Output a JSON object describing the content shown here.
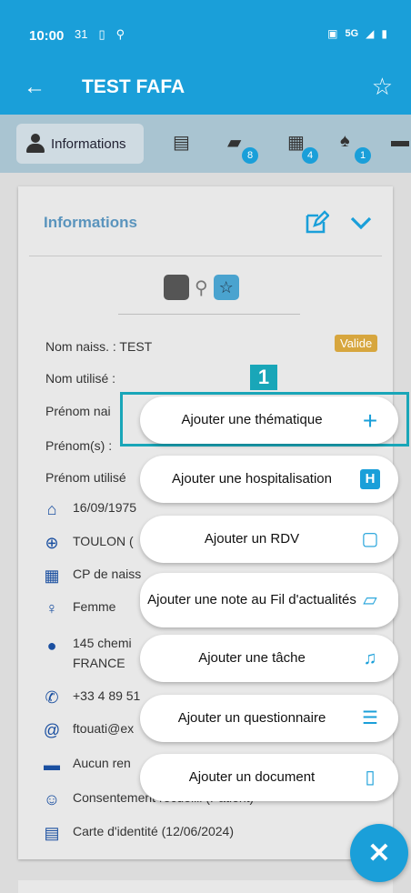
{
  "status": {
    "time": "10:00",
    "left_icons": [
      "31",
      "▯",
      "⚲"
    ],
    "net": "5G"
  },
  "appbar": {
    "back": "←",
    "title": "TEST FAFA",
    "star": "☆"
  },
  "tabs": {
    "info_label": "Informations",
    "badges": {
      "folder": "8",
      "forms": "4",
      "bell": "1"
    }
  },
  "card": {
    "title": "Informations",
    "status": "Valide"
  },
  "fields": [
    "Nom naiss. :  TEST",
    "Nom utilisé :",
    "Prénom nai",
    "Prénom(s) :",
    "Prénom utilisé"
  ],
  "details": [
    {
      "icon": "cake-icon",
      "glyph": "⌂",
      "text": "16/09/1975"
    },
    {
      "icon": "globe-icon",
      "glyph": "⊕",
      "text": "TOULON ("
    },
    {
      "icon": "building-icon",
      "glyph": "▦",
      "text": "CP de naiss"
    },
    {
      "icon": "gender-icon",
      "glyph": "♀",
      "text": "Femme"
    },
    {
      "icon": "location-icon",
      "glyph": "●",
      "text": "145 chemi\nFRANCE"
    },
    {
      "icon": "phone-icon",
      "glyph": "✆",
      "text": "+33 4 89 51"
    },
    {
      "icon": "at-icon",
      "glyph": "@",
      "text": "ftouati@ex"
    },
    {
      "icon": "calendar-icon",
      "glyph": "▬",
      "text": "Aucun ren"
    },
    {
      "icon": "smiley-icon",
      "glyph": "☺",
      "text": "Consentement recueilli (Patient)"
    },
    {
      "icon": "id-card-icon",
      "glyph": "▤",
      "text": "Carte d'identité (12/06/2024)"
    }
  ],
  "highlight_number": "1",
  "actions": [
    {
      "label": "Ajouter une thématique",
      "icon": "plus-icon",
      "glyph": "+"
    },
    {
      "label": "Ajouter une hospitalisation",
      "icon": "hospital-icon",
      "glyph": "H"
    },
    {
      "label": "Ajouter un RDV",
      "icon": "calendar-icon",
      "glyph": "▢"
    },
    {
      "label": "Ajouter une note au Fil d'actualités",
      "icon": "note-icon",
      "glyph": "▱"
    },
    {
      "label": "Ajouter une tâche",
      "icon": "bell-icon",
      "glyph": "♫"
    },
    {
      "label": "Ajouter un questionnaire",
      "icon": "list-icon",
      "glyph": "☰"
    },
    {
      "label": "Ajouter un document",
      "icon": "document-icon",
      "glyph": "▯"
    }
  ],
  "fab": "✕",
  "colors": {
    "primary": "#1a9fd9",
    "highlight": "#19a6b8",
    "valide": "#d7a63e"
  }
}
